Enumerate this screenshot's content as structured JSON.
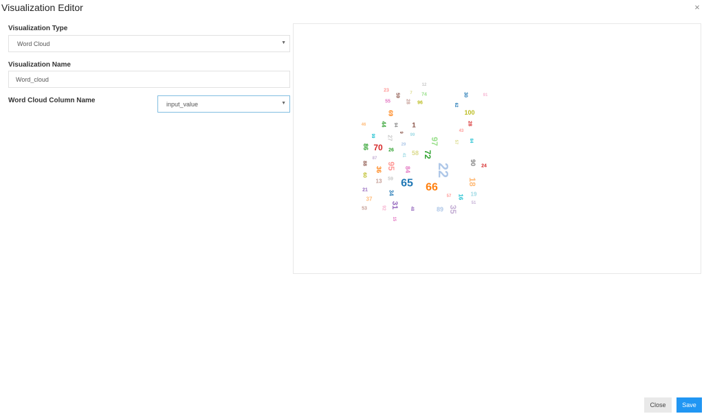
{
  "modal": {
    "title": "Visualization Editor",
    "close_icon": "×"
  },
  "form": {
    "type_label": "Visualization Type",
    "type_value": "Word Cloud",
    "name_label": "Visualization Name",
    "name_value": "Word_cloud",
    "column_label": "Word Cloud Column Name",
    "column_value": "input_value",
    "caret_icon": "▼"
  },
  "buttons": {
    "close_label": "Close",
    "save_label": "Save"
  },
  "chart_data": {
    "type": "wordcloud",
    "words": [
      {
        "text": "12",
        "size": 6,
        "color": "#c7c7c7"
      },
      {
        "text": "23",
        "size": 7,
        "color": "#ff9896"
      },
      {
        "text": "59",
        "size": 7,
        "color": "#8c564b",
        "rotate": 90
      },
      {
        "text": "7",
        "size": 6,
        "color": "#dbdb8d"
      },
      {
        "text": "74",
        "size": 7,
        "color": "#98df8a"
      },
      {
        "text": "30",
        "size": 7,
        "color": "#1f77b4",
        "rotate": 90
      },
      {
        "text": "91",
        "size": 6,
        "color": "#f7b6d2"
      },
      {
        "text": "55",
        "size": 7,
        "color": "#e377c2"
      },
      {
        "text": "28",
        "size": 7,
        "color": "#c49c94",
        "rotate": 90
      },
      {
        "text": "96",
        "size": 7,
        "color": "#bcbd22"
      },
      {
        "text": "62",
        "size": 6,
        "color": "#1f77b4",
        "rotate": 90
      },
      {
        "text": "69",
        "size": 8,
        "color": "#ff7f0e",
        "rotate": 90
      },
      {
        "text": "100",
        "size": 9,
        "color": "#bcbd22"
      },
      {
        "text": "46",
        "size": 6,
        "color": "#ffbb78"
      },
      {
        "text": "44",
        "size": 8,
        "color": "#2ca02c",
        "rotate": 90
      },
      {
        "text": "94",
        "size": 6,
        "color": "#7f7f7f",
        "rotate": 90
      },
      {
        "text": "1",
        "size": 10,
        "color": "#8c564b"
      },
      {
        "text": "28",
        "size": 7,
        "color": "#d62728",
        "rotate": 90
      },
      {
        "text": "43",
        "size": 6,
        "color": "#ff9896"
      },
      {
        "text": "99",
        "size": 6,
        "color": "#17becf",
        "rotate": 90
      },
      {
        "text": "27",
        "size": 8,
        "color": "#c7c7c7",
        "rotate": 90
      },
      {
        "text": "9",
        "size": 6,
        "color": "#8c564b",
        "rotate": 90
      },
      {
        "text": "99",
        "size": 6,
        "color": "#9edae5"
      },
      {
        "text": "97",
        "size": 12,
        "color": "#98df8a",
        "rotate": 90
      },
      {
        "text": "57",
        "size": 6,
        "color": "#dbdb8d",
        "rotate": 90
      },
      {
        "text": "84",
        "size": 6,
        "color": "#17becf",
        "rotate": 90
      },
      {
        "text": "86",
        "size": 9,
        "color": "#2ca02c",
        "rotate": 90
      },
      {
        "text": "70",
        "size": 12,
        "color": "#d62728"
      },
      {
        "text": "26",
        "size": 7,
        "color": "#2ca02c"
      },
      {
        "text": "29",
        "size": 6,
        "color": "#aec7e8"
      },
      {
        "text": "58",
        "size": 9,
        "color": "#dbdb8d"
      },
      {
        "text": "72",
        "size": 12,
        "color": "#2ca02c",
        "rotate": 90
      },
      {
        "text": "41",
        "size": 6,
        "color": "#9edae5",
        "rotate": 90
      },
      {
        "text": "87",
        "size": 6,
        "color": "#c5b0d5"
      },
      {
        "text": "88",
        "size": 7,
        "color": "#8c564b",
        "rotate": 90
      },
      {
        "text": "95",
        "size": 12,
        "color": "#ff9896",
        "rotate": 90
      },
      {
        "text": "36",
        "size": 9,
        "color": "#ff7f0e",
        "rotate": 90
      },
      {
        "text": "84",
        "size": 9,
        "color": "#e377c2",
        "rotate": 90
      },
      {
        "text": "22",
        "size": 20,
        "color": "#aec7e8",
        "rotate": 90
      },
      {
        "text": "90",
        "size": 9,
        "color": "#7f7f7f",
        "rotate": 90
      },
      {
        "text": "24",
        "size": 7,
        "color": "#d62728"
      },
      {
        "text": "60",
        "size": 7,
        "color": "#bcbd22",
        "rotate": 90
      },
      {
        "text": "13",
        "size": 8,
        "color": "#c49c94"
      },
      {
        "text": "59",
        "size": 7,
        "color": "#c7c7c7"
      },
      {
        "text": "65",
        "size": 16,
        "color": "#1f77b4"
      },
      {
        "text": "66",
        "size": 16,
        "color": "#ff7f0e"
      },
      {
        "text": "18",
        "size": 12,
        "color": "#ffbb78",
        "rotate": 90
      },
      {
        "text": "21",
        "size": 7,
        "color": "#9467bd"
      },
      {
        "text": "34",
        "size": 8,
        "color": "#1f77b4",
        "rotate": 90
      },
      {
        "text": "57",
        "size": 6,
        "color": "#ff9896"
      },
      {
        "text": "19",
        "size": 8,
        "color": "#9edae5"
      },
      {
        "text": "16",
        "size": 8,
        "color": "#17becf",
        "rotate": 90
      },
      {
        "text": "37",
        "size": 8,
        "color": "#ffbb78"
      },
      {
        "text": "51",
        "size": 6,
        "color": "#c5b0d5"
      },
      {
        "text": "31",
        "size": 11,
        "color": "#9467bd",
        "rotate": 90
      },
      {
        "text": "53",
        "size": 7,
        "color": "#c49c94"
      },
      {
        "text": "92",
        "size": 7,
        "color": "#f7b6d2",
        "rotate": 90
      },
      {
        "text": "48",
        "size": 6,
        "color": "#9467bd",
        "rotate": 90
      },
      {
        "text": "89",
        "size": 9,
        "color": "#aec7e8"
      },
      {
        "text": "35",
        "size": 12,
        "color": "#c5b0d5",
        "rotate": 90
      },
      {
        "text": "15",
        "size": 6,
        "color": "#e377c2",
        "rotate": 90
      }
    ]
  }
}
